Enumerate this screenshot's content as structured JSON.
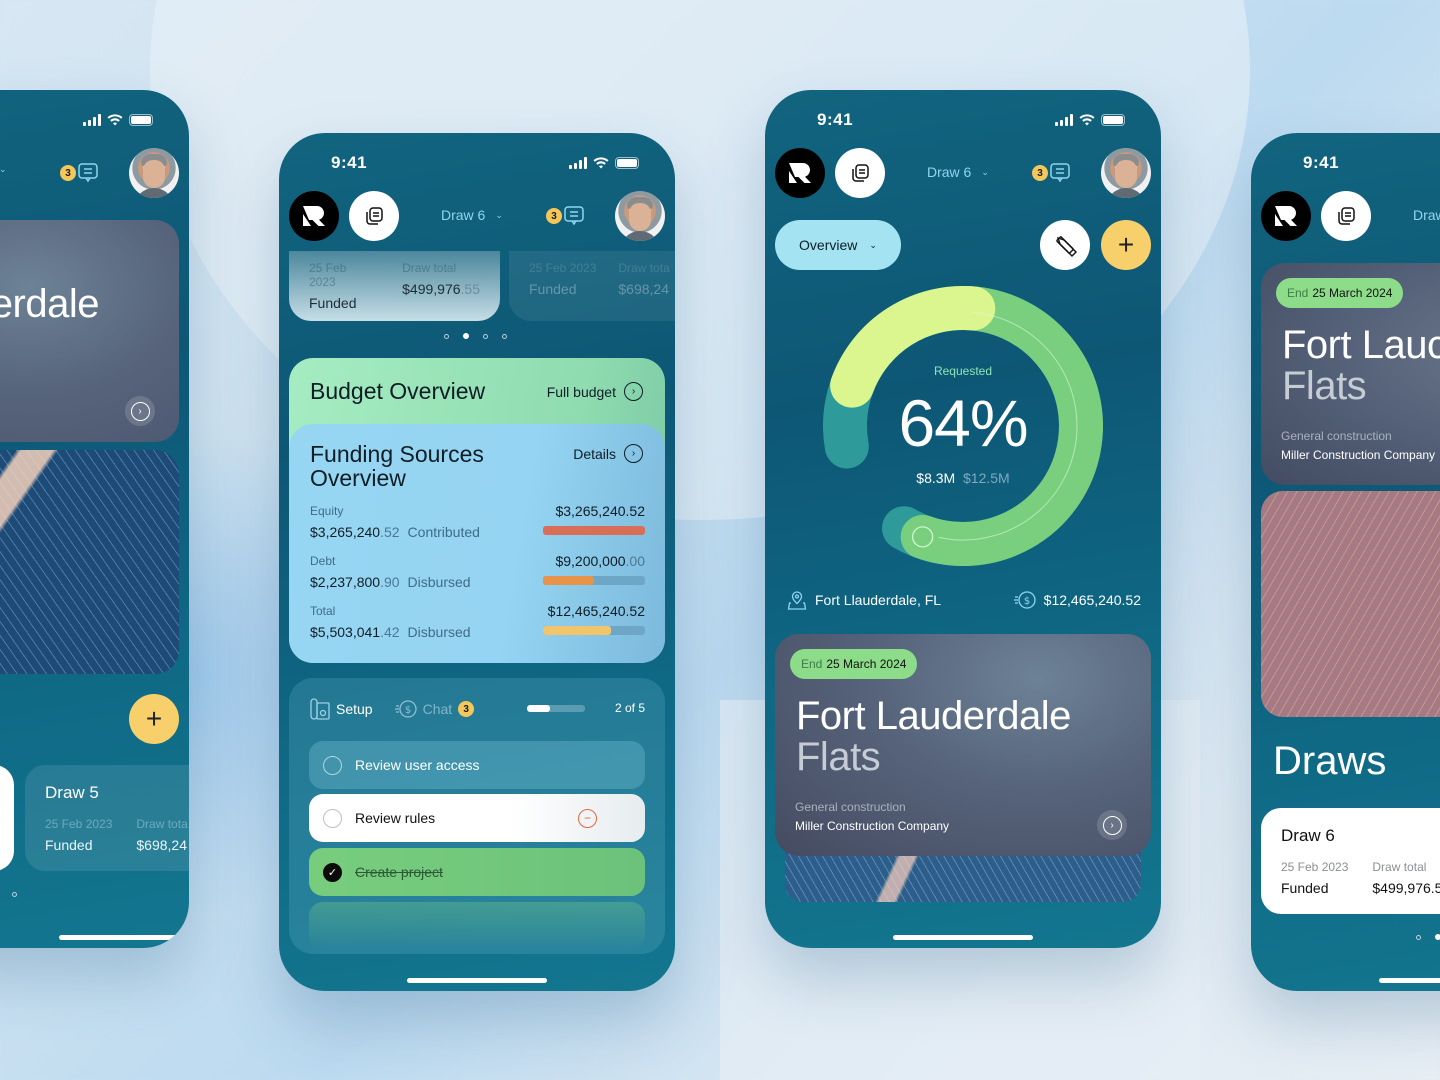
{
  "status_bar": {
    "time": "9:41"
  },
  "header": {
    "draw_selector": "Draw 6",
    "messages_badge": "3",
    "icons": {
      "logo": "r-logo-icon",
      "documents": "documents-icon",
      "messages": "chat-bubble-icon",
      "avatar": "user-avatar"
    }
  },
  "phone1": {
    "project_title_fragment": "erdale",
    "draw_card": {
      "title": "Draw 5",
      "date": "25 Feb 2023",
      "status": "Funded",
      "total_label": "Draw tota",
      "total": "$698,24"
    },
    "add_label": "+"
  },
  "phone2": {
    "draw_cards": [
      {
        "date": "25 Feb 2023",
        "status": "Funded",
        "total_label": "Draw total",
        "total_main": "$499,976",
        "total_cents": ".55"
      },
      {
        "date": "25 Feb 2023",
        "status": "Funded",
        "total_label": "Draw tota",
        "total_main": "$698,24",
        "total_cents": ""
      }
    ],
    "pager": {
      "count": 4,
      "active": 1
    },
    "budget": {
      "title": "Budget Overview",
      "link": "Full budget"
    },
    "funding": {
      "title": "Funding Sources Overview",
      "link": "Details",
      "rows": [
        {
          "label": "Equity",
          "amount_main": "$3,265,240",
          "amount_cents": ".52",
          "state": "Contributed",
          "total_main": "$3,265,240.52",
          "total_cents": "",
          "progress": 1.0,
          "color": "#d96e57"
        },
        {
          "label": "Debt",
          "amount_main": "$2,237,800",
          "amount_cents": ".90",
          "state": "Disbursed",
          "total_main": "$9,200,000",
          "total_cents": ".00",
          "progress": 0.5,
          "color": "#e8934a"
        },
        {
          "label": "Total",
          "amount_main": "$5,503,041",
          "amount_cents": ".42",
          "state": "Disbursed",
          "total_main": "$12,465,240.52",
          "total_cents": "",
          "progress": 0.67,
          "color": "#f0c56c"
        }
      ]
    },
    "tasks": {
      "tabs": [
        {
          "label": "Setup",
          "icon": "blueprint-icon"
        },
        {
          "label": "Chat",
          "icon": "dollar-chat-icon",
          "badge": "3"
        }
      ],
      "progress": 0.4,
      "progress_label": "2 of 5",
      "items": [
        {
          "label": "Review user access",
          "done": false
        },
        {
          "label": "Review rules",
          "done": false
        },
        {
          "label": "Create project",
          "done": true
        }
      ]
    }
  },
  "phone3": {
    "overview_select": "Overview",
    "donut": {
      "label": "Requested",
      "percent": "64%",
      "requested": "$8.3M",
      "total": "$12.5M",
      "value": 0.64
    },
    "location": "Fort Llauderdale, FL",
    "total_amount": "$12,465,240.52",
    "project": {
      "end_prefix": "End",
      "end_date": "25 March 2024",
      "title_line1": "Fort Lauderdale",
      "title_line2": "Flats",
      "category": "General construction",
      "contractor": "Miller Construction Company"
    }
  },
  "phone4": {
    "project": {
      "end_prefix": "End",
      "end_date": "25 March 2024",
      "title_line1": "Fort Lauc",
      "title_line2": "Flats",
      "category": "General construction",
      "contractor": "Miller Construction Company"
    },
    "draws_heading": "Draws",
    "draw_card": {
      "title": "Draw 6",
      "date": "25 Feb 2023",
      "status": "Funded",
      "total_label": "Draw total",
      "total": "$499,976.5"
    },
    "draw_selector_fragment": "Draw"
  }
}
